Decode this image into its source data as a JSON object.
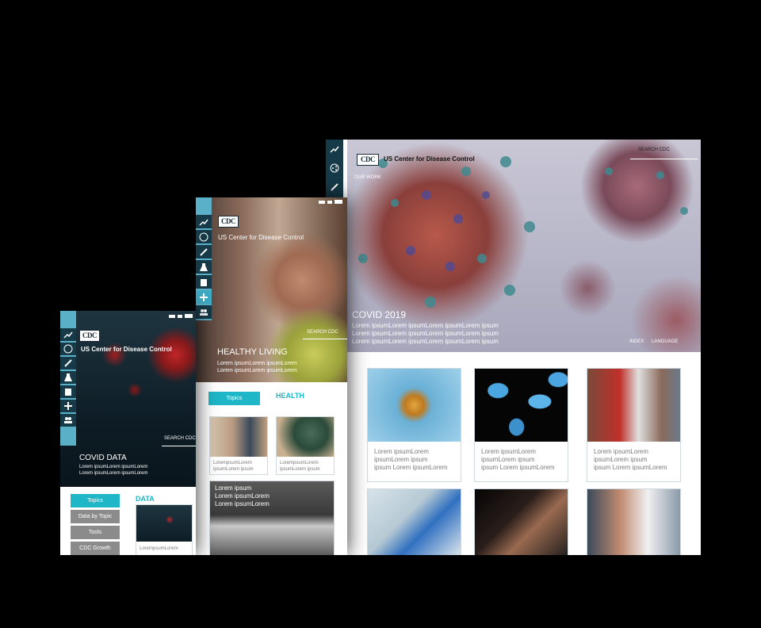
{
  "org_name": "US Center for Disease Control",
  "logo_text": "CDC",
  "desktop": {
    "search_label": "SEARCH CDC",
    "nav_link": "OUR WORK",
    "hero_title": "COVID 2019",
    "hero_lines": [
      "Lorem ipsumLorem ipsumLorem ipsumLorem ipsum",
      "Lorem ipsumLorem ipsumLorem ipsumLorem ipsum",
      "Lorem ipsumLorem ipsumLorem ipsumLorem ipsum"
    ],
    "footer_links": [
      "INDEX",
      "LANGUAGE"
    ],
    "cards": [
      {
        "lines": [
          "Lorem ipsumLorem",
          "ipsumLorem ipsum",
          " ipsum Lorem ipsumLorem"
        ]
      },
      {
        "lines": [
          "Lorem ipsumLorem",
          "ipsumLorem ipsum",
          " ipsum Lorem ipsumLorem"
        ]
      },
      {
        "lines": [
          "Lorem ipsumLorem",
          "ipsumLorem ipsum",
          " ipsum Lorem ipsumLorem"
        ]
      }
    ]
  },
  "tablet": {
    "search_label": "SEARCH CDC",
    "hero_title": "HEALTHY LIVING",
    "hero_lines": [
      "Lorem ipsumLorem ipsumLorem",
      "Lorem ipsumLorem ipsumLorem"
    ],
    "topics_button": "Topics",
    "section_label": "HEALTH",
    "cards": [
      {
        "lines": [
          "LorempsumLorem",
          "ipsumLorem ipsum"
        ]
      },
      {
        "lines": [
          "LorempsumLorem",
          "ipsumLorem ipsum"
        ]
      }
    ],
    "wide_card_lines": [
      "Lorem ipsum",
      "Lorem ipsumLorem",
      "Lorem ipsumLorem"
    ]
  },
  "phone": {
    "search_label": "SEARCH CDC",
    "hero_title": "COVID DATA",
    "hero_lines": [
      "Lorem ipsumLorem ipsumLorem",
      "Lorem ipsumLorem ipsumLorem"
    ],
    "menu": [
      "Topics",
      "Data by Topic",
      "Tools",
      "CDC Growth"
    ],
    "section_label": "DATA",
    "card_caption": "LorempsumLorem"
  },
  "icons": [
    "chart-icon",
    "share-icon",
    "syringe-icon",
    "flask-icon",
    "clipboard-icon",
    "plus-icon",
    "people-icon"
  ]
}
